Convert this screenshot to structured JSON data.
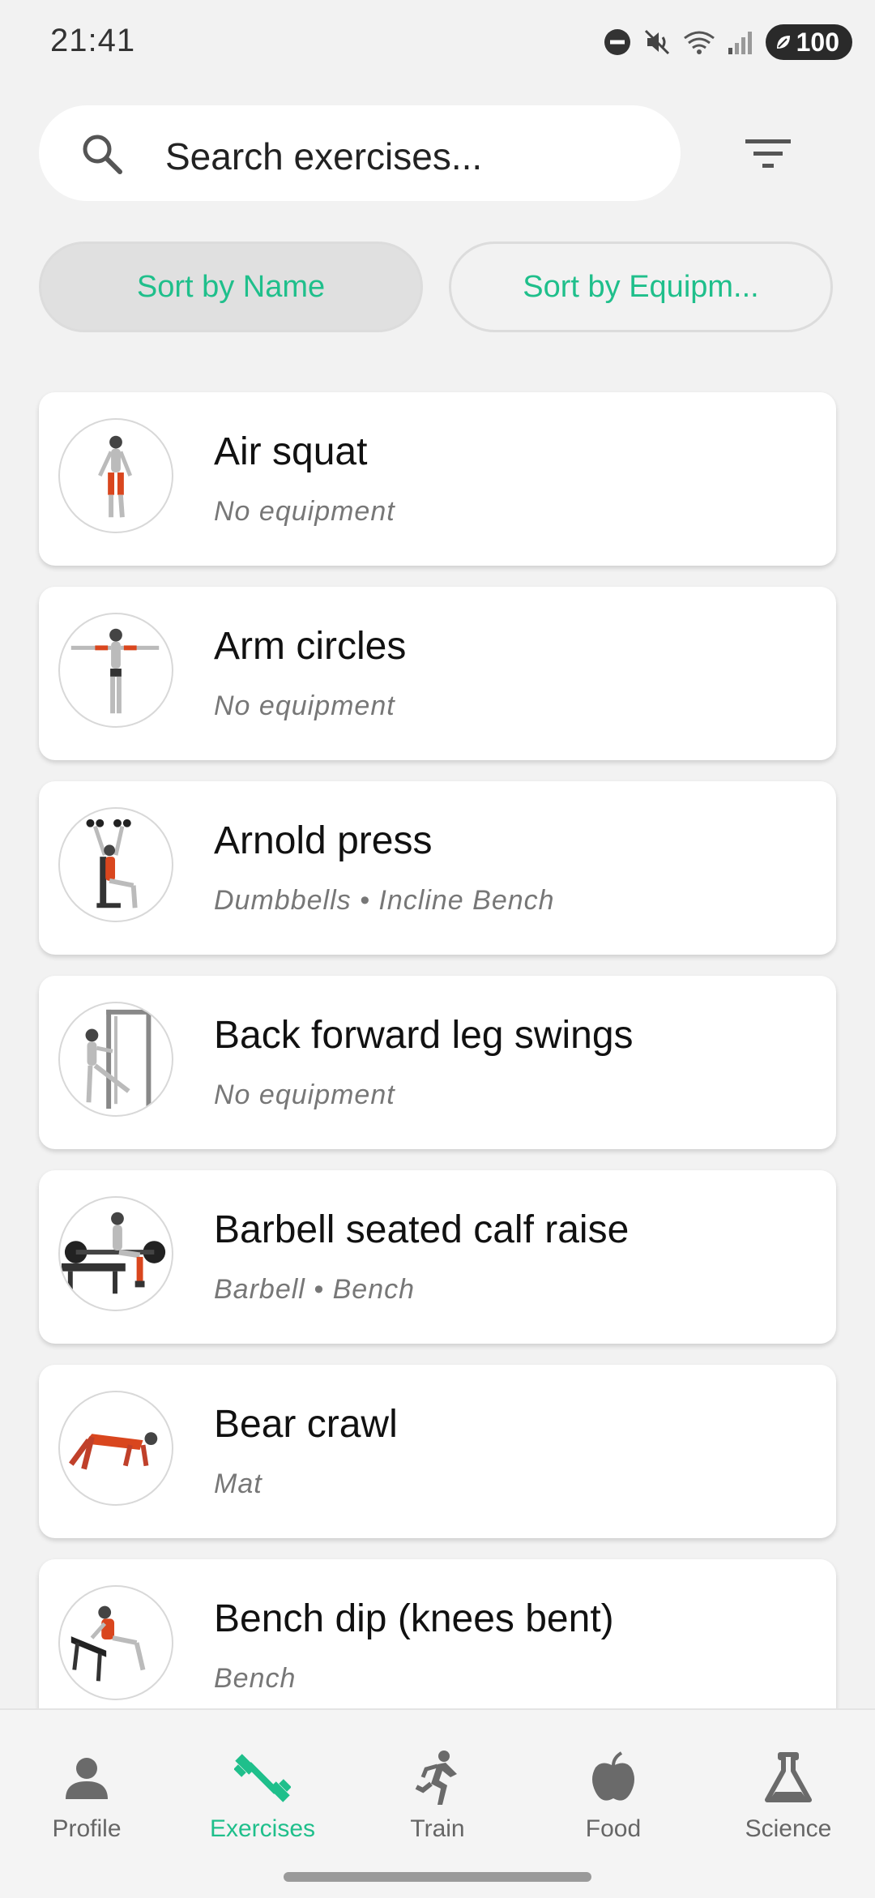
{
  "status_bar": {
    "time": "21:41",
    "battery": "100"
  },
  "search": {
    "placeholder": "Search exercises..."
  },
  "sort": {
    "by_name": "Sort by Name",
    "by_equipment": "Sort by Equipm..."
  },
  "colors": {
    "accent": "#1fbf8b",
    "muscle": "#d9461e"
  },
  "exercises": [
    {
      "name": "Air squat",
      "equipment": "No equipment",
      "icon": "air-squat-figure"
    },
    {
      "name": "Arm circles",
      "equipment": "No equipment",
      "icon": "arm-circles-figure"
    },
    {
      "name": "Arnold press",
      "equipment": "Dumbbells • Incline Bench",
      "icon": "arnold-press-figure"
    },
    {
      "name": "Back forward leg swings",
      "equipment": "No equipment",
      "icon": "leg-swings-figure"
    },
    {
      "name": "Barbell seated calf raise",
      "equipment": "Barbell • Bench",
      "icon": "calf-raise-figure"
    },
    {
      "name": "Bear crawl",
      "equipment": "Mat",
      "icon": "bear-crawl-figure"
    },
    {
      "name": "Bench dip (knees bent)",
      "equipment": "Bench",
      "icon": "bench-dip-figure"
    }
  ],
  "nav": [
    {
      "label": "Profile",
      "icon": "person-icon",
      "active": false
    },
    {
      "label": "Exercises",
      "icon": "dumbbell-icon",
      "active": true
    },
    {
      "label": "Train",
      "icon": "running-icon",
      "active": false
    },
    {
      "label": "Food",
      "icon": "apple-icon",
      "active": false
    },
    {
      "label": "Science",
      "icon": "flask-icon",
      "active": false
    }
  ]
}
